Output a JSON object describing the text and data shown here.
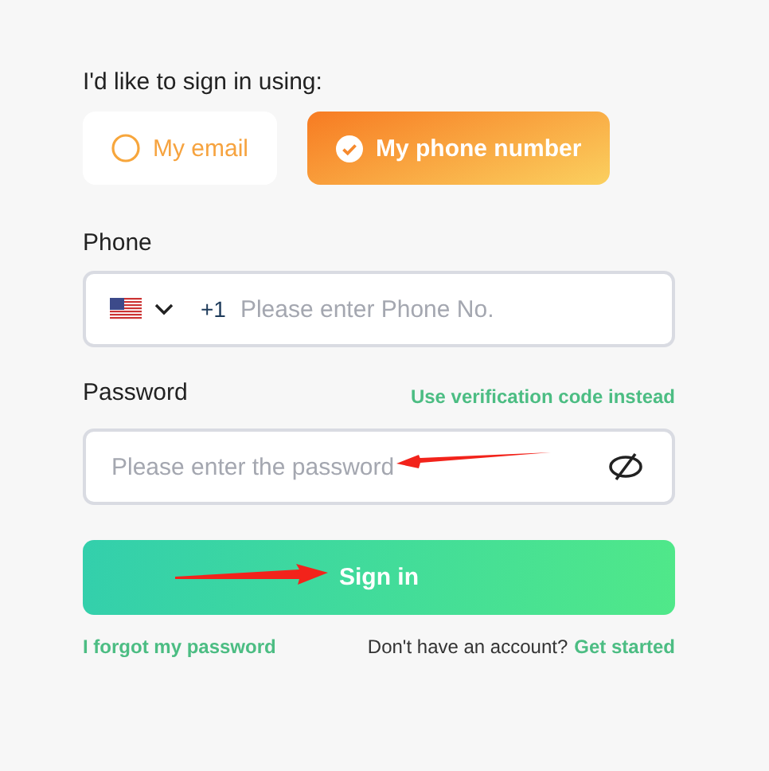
{
  "prompt": "I'd like to sign in using:",
  "methods": [
    {
      "label": "My email",
      "selected": false
    },
    {
      "label": "My phone number",
      "selected": true
    }
  ],
  "phone": {
    "label": "Phone",
    "country_code": "+1",
    "placeholder": "Please enter Phone No."
  },
  "password": {
    "label": "Password",
    "alt_link": "Use verification code instead",
    "placeholder": "Please enter the password"
  },
  "submit": "Sign in",
  "forgot_link": "I forgot my password",
  "signup": {
    "question": "Don't have an account?",
    "link": "Get started"
  }
}
